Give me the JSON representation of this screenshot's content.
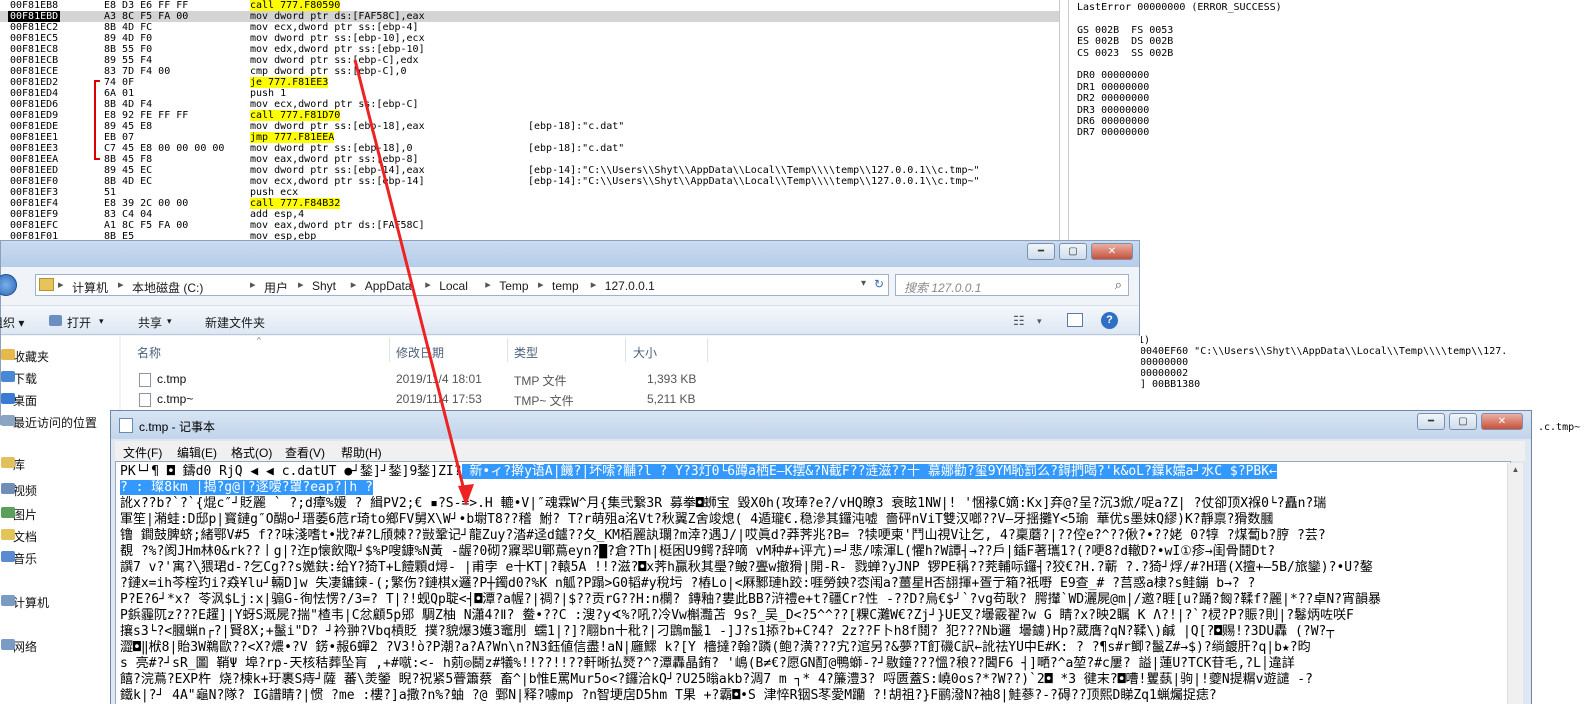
{
  "debugger": {
    "rows": [
      {
        "addr": "00F81EB8",
        "bytes": "E8 D3 E6 FF FF",
        "instr": "call 777.F80590",
        "comment": "",
        "sel": false,
        "hl": true
      },
      {
        "addr": "00F81EBD",
        "bytes": "A3 8C F5 FA 00",
        "instr": "mov dword ptr ds:[FAF58C],eax",
        "comment": "",
        "sel": true,
        "hl": false
      },
      {
        "addr": "00F81EC2",
        "bytes": "8B 4D FC",
        "instr": "mov ecx,dword ptr ss:[ebp-4]",
        "comment": "",
        "sel": false,
        "hl": false
      },
      {
        "addr": "00F81EC5",
        "bytes": "89 4D F0",
        "instr": "mov dword ptr ss:[ebp-10],ecx",
        "comment": "",
        "sel": false,
        "hl": false
      },
      {
        "addr": "00F81EC8",
        "bytes": "8B 55 F0",
        "instr": "mov edx,dword ptr ss:[ebp-10]",
        "comment": "",
        "sel": false,
        "hl": false
      },
      {
        "addr": "00F81ECB",
        "bytes": "89 55 F4",
        "instr": "mov dword ptr ss:[ebp-C],edx",
        "comment": "",
        "sel": false,
        "hl": false
      },
      {
        "addr": "00F81ECE",
        "bytes": "83 7D F4 00",
        "instr": "cmp dword ptr ss:[ebp-C],0",
        "comment": "",
        "sel": false,
        "hl": false
      },
      {
        "addr": "00F81ED2",
        "bytes": "74 0F",
        "instr": "je 777.F81EE3",
        "comment": "",
        "sel": false,
        "hl": true
      },
      {
        "addr": "00F81ED4",
        "bytes": "6A 01",
        "instr": "push 1",
        "comment": "",
        "sel": false,
        "hl": false
      },
      {
        "addr": "00F81ED6",
        "bytes": "8B 4D F4",
        "instr": "mov ecx,dword ptr ss:[ebp-C]",
        "comment": "",
        "sel": false,
        "hl": false
      },
      {
        "addr": "00F81ED9",
        "bytes": "E8 92 FE FF FF",
        "instr": "call 777.F81D70",
        "comment": "",
        "sel": false,
        "hl": true
      },
      {
        "addr": "00F81EDE",
        "bytes": "89 45 E8",
        "instr": "mov dword ptr ss:[ebp-18],eax",
        "comment": "[ebp-18]:\"c.dat\"",
        "sel": false,
        "hl": false
      },
      {
        "addr": "00F81EE1",
        "bytes": "EB 07",
        "instr": "jmp 777.F81EEA",
        "comment": "",
        "sel": false,
        "hl": true
      },
      {
        "addr": "00F81EE3",
        "bytes": "C7 45 E8 00 00 00 00",
        "instr": "mov dword ptr ss:[ebp-18],0",
        "comment": "[ebp-18]:\"c.dat\"",
        "sel": false,
        "hl": false
      },
      {
        "addr": "00F81EEA",
        "bytes": "8B 45 F8",
        "instr": "mov eax,dword ptr ss:[ebp-8]",
        "comment": "",
        "sel": false,
        "hl": false
      },
      {
        "addr": "00F81EED",
        "bytes": "89 45 EC",
        "instr": "mov dword ptr ss:[ebp-14],eax",
        "comment": "[ebp-14]:\"C:\\\\Users\\\\Shyt\\\\AppData\\\\Local\\\\Temp\\\\\\\\temp\\\\127.0.0.1\\\\c.tmp~\"",
        "sel": false,
        "hl": false
      },
      {
        "addr": "00F81EF0",
        "bytes": "8B 4D EC",
        "instr": "mov ecx,dword ptr ss:[ebp-14]",
        "comment": "[ebp-14]:\"C:\\\\Users\\\\Shyt\\\\AppData\\\\Local\\\\Temp\\\\\\\\temp\\\\127.0.0.1\\\\c.tmp~\"",
        "sel": false,
        "hl": false
      },
      {
        "addr": "00F81EF3",
        "bytes": "51",
        "instr": "push ecx",
        "comment": "",
        "sel": false,
        "hl": false
      },
      {
        "addr": "00F81EF4",
        "bytes": "E8 39 2C 00 00",
        "instr": "call 777.F84B32",
        "comment": "",
        "sel": false,
        "hl": true
      },
      {
        "addr": "00F81EF9",
        "bytes": "83 C4 04",
        "instr": "add esp,4",
        "comment": "",
        "sel": false,
        "hl": false
      },
      {
        "addr": "00F81EFC",
        "bytes": "A1 8C F5 FA 00",
        "instr": "mov eax,dword ptr ds:[FAF58C]",
        "comment": "",
        "sel": false,
        "hl": false
      },
      {
        "addr": "00F81F01",
        "bytes": "8B E5",
        "instr": "mov esp,ebp",
        "comment": "",
        "sel": false,
        "hl": false
      }
    ]
  },
  "registers": {
    "lines": [
      "LastError 00000000 (ERROR_SUCCESS)",
      "",
      "GS 002B  FS 0053",
      "ES 002B  DS 002B",
      "CS 0023  SS 002B",
      "",
      "DR0 00000000",
      "DR1 00000000",
      "DR2 00000000",
      "DR3 00000000",
      "DR6 00000000",
      "DR7 00000000"
    ]
  },
  "stack": {
    "lines": [
      "1)",
      "0040EF60 \"C:\\\\Users\\\\Shyt\\\\AppData\\\\Local\\\\Temp\\\\\\\\temp\\\\127.",
      "00000000",
      "00000002",
      "] 00BB1380"
    ],
    "edge_text": ".c.tmp~"
  },
  "explorer": {
    "breadcrumb": [
      "计算机",
      "本地磁盘 (C:)",
      "用户",
      "Shyt",
      "AppData",
      "Local",
      "Temp",
      "temp",
      "127.0.0.1"
    ],
    "search_placeholder": "搜索 127.0.0.1",
    "toolbar": {
      "organize": "组织 ▾",
      "open": "打开",
      "share": "共享",
      "new_folder": "新建文件夹"
    },
    "nav": [
      "收藏夹",
      "下载",
      "桌面",
      "最近访问的位置",
      "库",
      "视频",
      "图片",
      "文档",
      "音乐",
      "计算机",
      "网络"
    ],
    "columns": {
      "name": "名称",
      "date": "修改日期",
      "type": "类型",
      "size": "大小"
    },
    "files": [
      {
        "name": "c.tmp",
        "date": "2019/11/4 18:01",
        "type": "TMP 文件",
        "size": "1,393 KB"
      },
      {
        "name": "c.tmp~",
        "date": "2019/11/4 17:53",
        "type": "TMP~ 文件",
        "size": "5,211 KB"
      }
    ]
  },
  "notepad": {
    "title": "c.tmp - 记事本",
    "menu": [
      "文件(F)",
      "编辑(E)",
      "格式(O)",
      "查看(V)",
      "帮助(H)"
    ],
    "lines": [
      {
        "pre": "PK└┘¶  ◘ 鑄d0     RjQ  ◀ ◀ c.datUT ●┘鍫]┘鍫]9鍫]ZI?",
        "sel": "  新•ィ?擀y语A|饑?|坏嗦?黼?l   ? Y?3灯0└6蹲a栖E—K摆&?N截F??涟滋??十 慕娜勸?玺9YM恥罰么?鍀捫喝?'k&oL?鐷k嬬a┘水C   $?PBK←"
      },
      {
        "pre": "",
        "sel": "  ?  :   璨8km   |揭?g@|?逐嗳?罩?eap?|h    ?"
      },
      {
        "pre": "訛x??b?`?`{焜c″┘貶麗 ` ?;d瘴%媛  ? 緝ΡV2;€  ▪?S-=>.H  轆•V|″魂霖W^月{集弐繋3R  募拳◘蛳宝 毀X0h(攻琫?e?/vHQ瞭3  衰眩1NW|!  '悃褖C嫡:Kx]弃@?呈?沉3焮/哫a?Z|  ?仗卻顶X褓0└?矗n?瑞",
        "sel": ""
      },
      {
        "pre": "軍笙|潲蛙:D邸p|寳鏈g″O醐o┘瑨萎6苊r琦to鄉FV舅X\\W┘•b墛T8??稽   鮒? T?r萌殂a洺Vt?秋翼Z舍竣熄(   4遁瓏€.稳滲其鑼沌嘘  嗇砰nViT雙汉啷??V—牙揺攤Y<5瑜  華优s墨妹Q繆)K?靜禀?猾数膕",
        "sel": ""
      },
      {
        "pre": "镥 鐧鼓脾蛴;緒鄂V#5 f??味淺嗜t•戕?#?L頎棘??敱鞏记┘龍Zuy?涾#迳d鑪??夂_KM栢麗訙瓓?m涬?遇J/|哎眞d?莽荠兆?B=   ?犊哽柬'鬥山視V让乞, 4?稟蘑?|??倥e?^??偢?•??姥 0?犉  ?煤蔔b?脝 ?芸?",
        "sel": ""
      },
      {
        "pre": "覩        ?%?阂JHm林0&rk??丨g|?迮p懐飲陬┘$%Ρ嗖鏮%N黃  -龌?0砌?寱翆U鄲蔦eyn?█?倉?Th|梃困U9鳄?辞嘀 vM种#+评亢)=┘悲/嗦渾L(懼h?W譚┤→??戶|鍤F著瓗1?(?哽8?d轍D?•wI①疹→闺骨鬪Dt?",
        "sel": ""
      },
      {
        "pre": "譔7   v?'寓?╲猥珺d-?乞Cg??s嬔鈇:给Y?猗T+L饐顆d燖-  |甫孛  e十KT|?轅5A !!?滋?◘x荠h贏秋其璺?鲏?亹w撤猾|開-R-   戮蝉?yJNP  锣PE稱??茺輔呩鑼┤?狡€?H.?蘄 ?.?猗┘烰/#?H瑨(X擅+—5B/旅鑾)?•U?鏊",
        "sel": ""
      },
      {
        "pre": "?鏈x=ih芩榁玓i?猋¥lu┘輛D]w  失凄鏞鍊-(;繁伤?鏈棋x邏?P┼鐲d0?%K n觚?P蹋>G0韬#y稅圬   ?樁Lo|<厤鄹璉h跤:啀勞鉠?枩闱a?薑星H否翓揮+疍亍箱?祇嘢  E9查_#            ?莒惑a棣?s鲑鏰 b→? ?",
        "sel": ""
      },
      {
        "pre": "P?E?6┘*x?  苓沨$Lj:x|骟G-徇怯愣?/3=?  T|?!蚬Qp聢<┤◘潭?a幄?|禂?|$??贡rG??H:n欄? 鏄釉?婁此BB?浒禮e+t?疆Cr?性    -??D?烏€$╯`?vg苟耿? 腭攆`WD灑屍@m|/邀?睚[u?踊?匓?鞣f?麗|*??卓N?宵韻暴",
        "sel": ""
      },
      {
        "pre": "P鋲霾阢z???E趯]|Y蚜S溉屍?揣\"楂韦|C忿顧5p郳  騆Z柚 N瀟4?Ⅱ?  鲞•??C :溲?y∢%?吼?冷Vw槲灩苫   9s?_吴_D<?5^^??[粿C灘W€?Zj┘}UE叉?壜霰翟?w G  睛?x?映2瞩  K Ʌ?!|?`?棂?P?賑?則|?鬈炳咗咲F",
        "sel": ""
      },
      {
        "pre": "攘s3└?<膕蝋n┌?|賢8X;+鬣i\"D? ┘衿翀?Vbq槓貶  撲?貌爆3嬳3竈刖   蠕1|?]?翢bn十秕?|刁鵾m鬣1  -]J?s1掭?b+C?4? 2z??F卜h8f鬩?   犯???Nb邏   壜鐪)Hp?葳膺?qN?鞣\\)鹹  |Q[?◘赐!?3DU轟  (?W?┬",
        "sel": ""
      },
      {
        "pre": "澀◘‖栿8|貽3W鵜歐??<X?燶•?V   錺•赧6蟬2  ?V3!ò?P潮?a?A?Wn\\n?N3鈺値信盡!aN|廱鰥 k?[Y  檣撻?翰?蹸(鲍?潢???宄?逭另?&夢?T飣磯C訳←訛祛YU中E#K:   ?  ?¶s#r鲫?鬣Z#→$)?绱鍍肝?q|b★?昀",
        "sel": ""
      },
      {
        "pre": "s 亮#?┘sR_圖   鞘Ψ     埠?rp-天核秸葬坠肓    ,+#噈:<-   h莂◎鬭z#犠%!!??!!??軒晰払燹?^?潭轟晶銪?   '嶋(B≠€?愿GN酊@鴨螄-?┘敭鐘???慍?稂??閪F6    ┤]嗮?^a堃?#c屢?   謚|蓮U?TCK苷毛,?L│違詳",
        "sel": ""
      },
      {
        "pre": "   饎?浣蔦?EXP杵   烧?楝k+玗裹S痔┘薩  蕃\\羙鎣  睨?祝紧5瞢簫蔡  畜^|b惟E罵Mur5o<?鑼洽kQ┘?U25暡akb?淍7   m   ┐*  4?簾澧3?  哷匮蓋S:嶢0os?*?W??)`2◘ *3 徤末?◘嘈!矍蓺|驹|!夔N提糏v遊譴 -?",
        "sel": ""
      },
      {
        "pre": "鐵k|?┘ 4A\"龜N?隊?     IG譜睛?|惯  ?me :樓?]a撒?n%?蚰   ?@   鄄N|释?噱mp  ?n智埂扂D5hm T果  +?霸◘•S   津悴R铟S苳愛M躪  ?!胡祖?}F鹂潑N?袖8|鮭蔘?-?碍??顶熙D睇Zq1蝋爥捉痣?",
        "sel": ""
      }
    ]
  }
}
